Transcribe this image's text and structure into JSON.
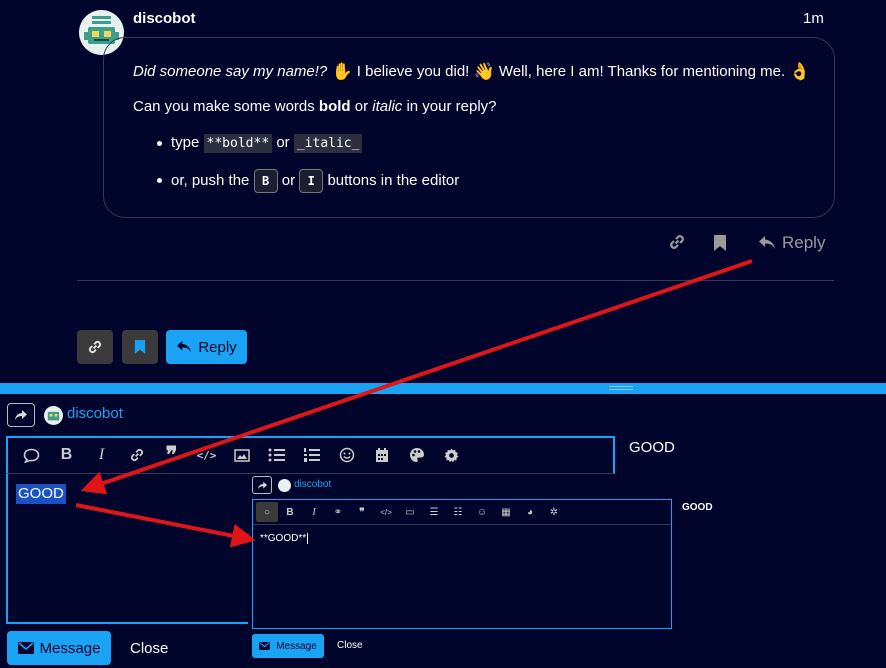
{
  "post": {
    "username": "discobot",
    "time": "1m",
    "line1_italic": "Did someone say my name!?",
    "line1_rest_a": "I believe you did!",
    "line1_rest_b": "Well, here I am! Thanks for mentioning me.",
    "line2_a": "Can you make some words",
    "line2_bold": "bold",
    "line2_or": "or",
    "line2_italic": "italic",
    "line2_b": "in your reply?",
    "bullet1_type": "type",
    "bullet1_code1": "**bold**",
    "bullet1_or": "or",
    "bullet1_code2": "_italic_",
    "bullet2_a": "or, push the",
    "bullet2_key1": "B",
    "bullet2_or": "or",
    "bullet2_key2": "I",
    "bullet2_b": "buttons in the editor",
    "reply_label": "Reply"
  },
  "topic_actions": {
    "reply_label": "Reply"
  },
  "composer": {
    "reply_to": "discobot",
    "editor_text": "GOOD",
    "preview_text": "GOOD",
    "message_label": "Message",
    "close_label": "Close"
  },
  "composer_zoom": {
    "reply_to": "discobot",
    "editor_text": "**GOOD**",
    "preview_text": "GOOD",
    "message_label": "Message",
    "close_label": "Close"
  },
  "colors": {
    "background": "#01042b",
    "accent": "#1aa3f5",
    "annotation_arrow": "#e0151a"
  },
  "icons": [
    "link-icon",
    "bookmark-icon",
    "reply-icon",
    "forward-icon",
    "quote-icon",
    "bold-icon",
    "italic-icon",
    "blockquote-icon",
    "code-icon",
    "image-icon",
    "bullet-list-icon",
    "numbered-list-icon",
    "emoji-icon",
    "calendar-icon",
    "palette-icon",
    "gear-icon",
    "envelope-icon"
  ]
}
